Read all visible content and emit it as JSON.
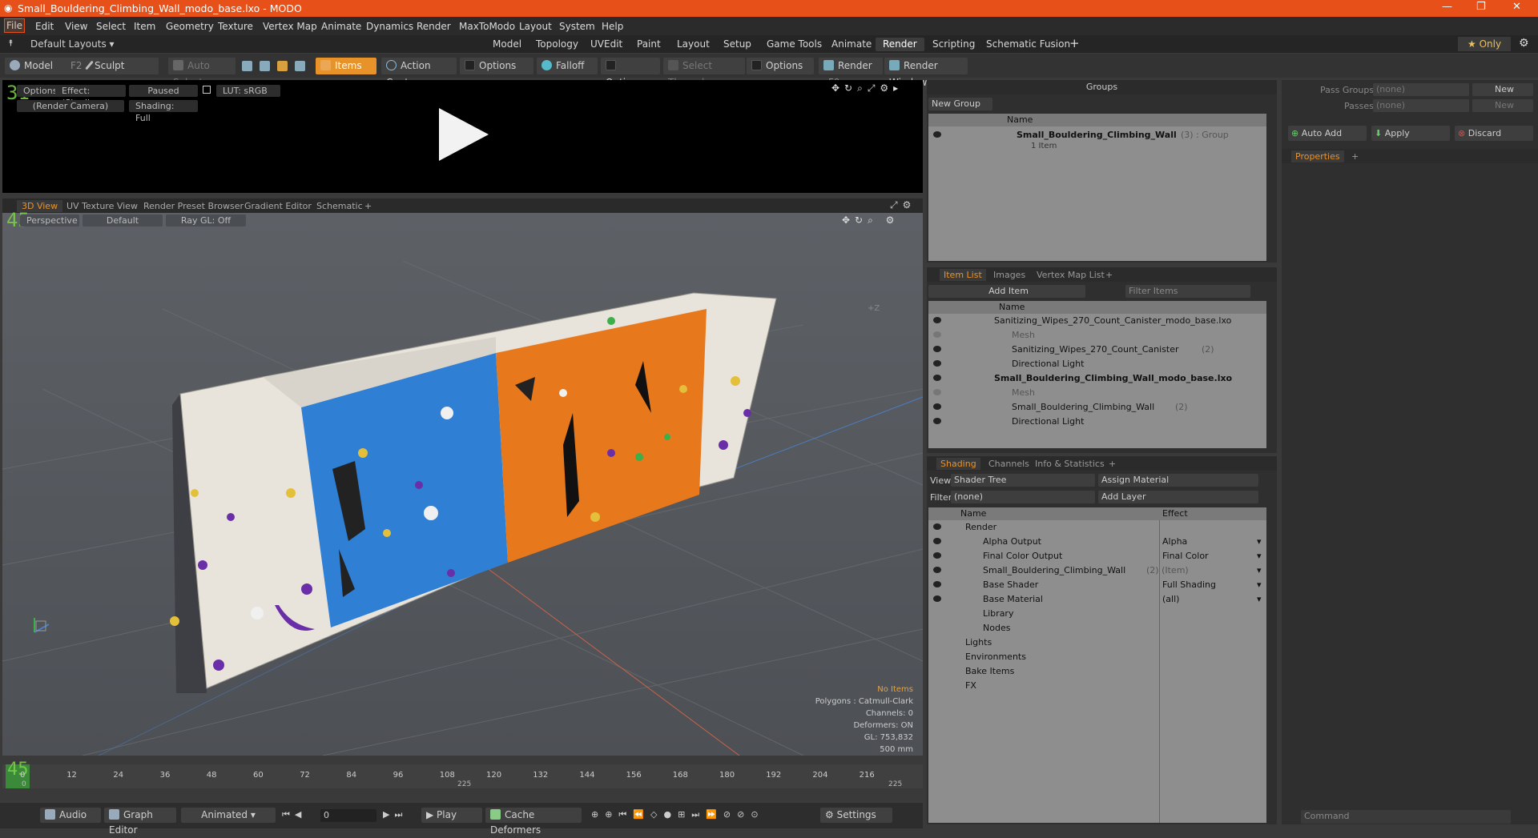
{
  "window": {
    "title": "Small_Bouldering_Climbing_Wall_modo_base.lxo - MODO",
    "controls": [
      "—",
      "❐",
      "✕"
    ]
  },
  "menu": [
    "File",
    "Edit",
    "View",
    "Select",
    "Item",
    "Geometry",
    "Texture",
    "Vertex Map",
    "Animate",
    "Dynamics",
    "Render",
    "MaxToModo",
    "Layout",
    "System",
    "Help"
  ],
  "layouts": {
    "label": "Default Layouts ▾",
    "tabs": [
      "Model",
      "Topology",
      "UVEdit",
      "Paint",
      "Layout",
      "Setup",
      "Game Tools",
      "Animate",
      "Render",
      "Scripting",
      "Schematic Fusion"
    ],
    "active": "Render",
    "only": "★  Only"
  },
  "toolbar": {
    "model": "Model",
    "model_key": "F2",
    "sculpt": "Sculpt",
    "auto_select": "Auto Select",
    "items": "Items",
    "action_center": "Action Center",
    "options": "Options",
    "falloff": "Falloff",
    "select_through": "Select Through",
    "render": "Render",
    "render_key": "F9",
    "render_window": "Render Window"
  },
  "preview": {
    "options": "Options",
    "effect": "Effect: (Shadi...",
    "paused": "Paused",
    "lut": "LUT: sRGB",
    "camera": "(Render Camera)",
    "shading": "Shading: Full",
    "counter": "31"
  },
  "viewport": {
    "tabs": [
      "3D View",
      "UV Texture View",
      "Render Preset Browser",
      "Gradient Editor",
      "Schematic"
    ],
    "active_tab": "3D View",
    "perspective": "Perspective",
    "default": "Default",
    "raygl": "Ray GL: Off",
    "counter": "45",
    "axis_label": "+Z",
    "stats": {
      "no_items": "No Items",
      "polygons": "Polygons : Catmull-Clark",
      "channels": "Channels: 0",
      "deformers": "Deformers: ON",
      "gl": "GL: 753,832",
      "size": "500 mm"
    }
  },
  "timeline": {
    "ticks": [
      "0",
      "12",
      "24",
      "36",
      "48",
      "60",
      "72",
      "84",
      "96",
      "108",
      "120",
      "132",
      "144",
      "156",
      "168",
      "180",
      "192",
      "204",
      "216"
    ],
    "start": "0",
    "end": "225",
    "mid": "225"
  },
  "transport": {
    "audio": "Audio",
    "graph_editor": "Graph Editor",
    "animated": "Animated",
    "frame": "0",
    "play": "Play",
    "cache": "Cache Deformers",
    "settings": "Settings"
  },
  "groups": {
    "title": "Groups",
    "new_group": "New Group",
    "col_name": "Name",
    "item_name": "Small_Bouldering_Climbing_Wall",
    "item_suffix": "(3) : Group",
    "item_sub": "1 Item"
  },
  "passes": {
    "pass_groups": "Pass Groups",
    "passes": "Passes",
    "none": "(none)",
    "new": "New",
    "auto_add": "Auto Add",
    "apply": "Apply",
    "discard": "Discard",
    "properties": "Properties"
  },
  "itemlist": {
    "tabs": [
      "Item List",
      "Images",
      "Vertex Map List"
    ],
    "active": "Item List",
    "add_item": "Add Item",
    "filter": "Filter Items",
    "col_name": "Name",
    "rows": [
      {
        "name": "Sanitizing_Wipes_270_Count_Canister_modo_base.lxo",
        "indent": 0,
        "bold": false,
        "grey": false
      },
      {
        "name": "Mesh",
        "indent": 1,
        "bold": false,
        "grey": true
      },
      {
        "name": "Sanitizing_Wipes_270_Count_Canister",
        "suffix": "(2)",
        "indent": 1,
        "bold": false,
        "grey": false
      },
      {
        "name": "Directional Light",
        "indent": 1,
        "bold": false,
        "grey": false
      },
      {
        "name": "Small_Bouldering_Climbing_Wall_modo_base.lxo",
        "indent": 0,
        "bold": true,
        "grey": false
      },
      {
        "name": "Mesh",
        "indent": 1,
        "bold": false,
        "grey": true
      },
      {
        "name": "Small_Bouldering_Climbing_Wall",
        "suffix": "(2)",
        "indent": 1,
        "bold": false,
        "grey": false
      },
      {
        "name": "Directional Light",
        "indent": 1,
        "bold": false,
        "grey": false
      }
    ]
  },
  "shading": {
    "tabs": [
      "Shading",
      "Channels",
      "Info & Statistics"
    ],
    "active": "Shading",
    "view_label": "View",
    "view_value": "Shader Tree",
    "assign": "Assign Material",
    "filter_label": "Filter",
    "filter_value": "(none)",
    "add_layer": "Add Layer",
    "col_name": "Name",
    "col_effect": "Effect",
    "rows": [
      {
        "name": "Render",
        "effect": "",
        "indent": 0
      },
      {
        "name": "Alpha Output",
        "effect": "Alpha",
        "indent": 1
      },
      {
        "name": "Final Color Output",
        "effect": "Final Color",
        "indent": 1
      },
      {
        "name": "Small_Bouldering_Climbing_Wall",
        "suffix": "(2) (Item)",
        "effect": "",
        "indent": 1
      },
      {
        "name": "Base Shader",
        "effect": "Full Shading",
        "indent": 1
      },
      {
        "name": "Base Material",
        "effect": "(all)",
        "indent": 1
      },
      {
        "name": "Library",
        "effect": "",
        "indent": 1
      },
      {
        "name": "Nodes",
        "effect": "",
        "indent": 1
      },
      {
        "name": "Lights",
        "effect": "",
        "indent": 0
      },
      {
        "name": "Environments",
        "effect": "",
        "indent": 0
      },
      {
        "name": "Bake Items",
        "effect": "",
        "indent": 0
      },
      {
        "name": "FX",
        "effect": "",
        "indent": 0
      }
    ]
  },
  "command": {
    "placeholder": "Command"
  }
}
